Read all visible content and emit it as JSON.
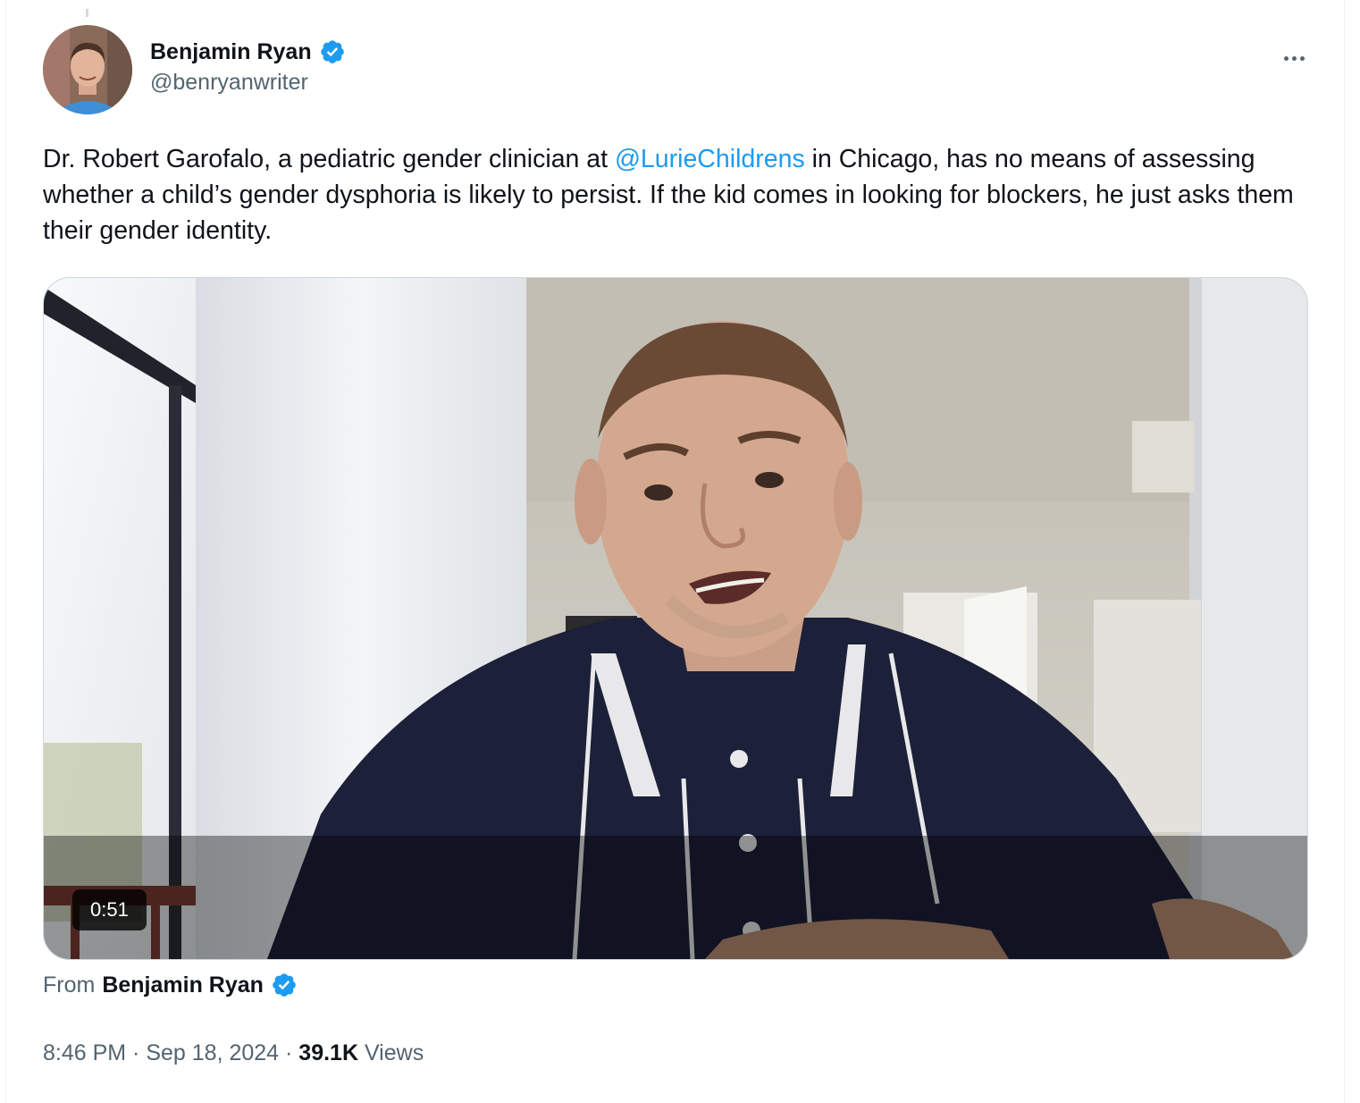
{
  "author": {
    "name": "Benjamin Ryan",
    "handle": "@benryanwriter",
    "verified": true,
    "avatar_icon": "user-avatar"
  },
  "tweet": {
    "text_before": "Dr. Robert Garofalo, a pediatric gender clinician at ",
    "mention": "@LurieChildrens",
    "text_after": " in Chicago, has no means of assessing whether a child’s gender dysphoria is likely to persist. If the kid comes in looking for blockers, he just asks them their gender identity."
  },
  "video": {
    "duration": "0:51"
  },
  "source": {
    "from_label": "From",
    "name": "Benjamin Ryan"
  },
  "meta": {
    "time": "8:46 PM",
    "separator": " · ",
    "date": "Sep 18, 2024",
    "views_count": "39.1K",
    "views_label": " Views"
  },
  "icons": {
    "more": "more-options-icon",
    "verified": "verified-badge-icon"
  },
  "colors": {
    "link": "#1d9bf0",
    "secondary_text": "#536471",
    "primary_text": "#0f1419",
    "verified": "#1d9bf0"
  }
}
